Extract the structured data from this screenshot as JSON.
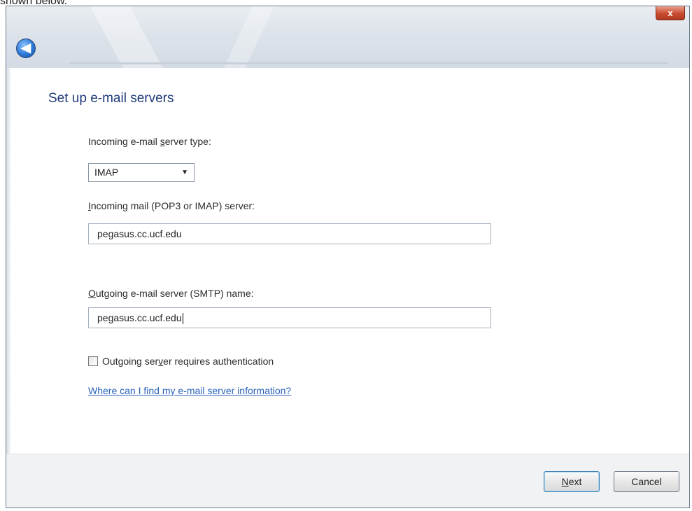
{
  "caption": "shown below.",
  "window": {
    "close_label": "x",
    "back_label": "◀"
  },
  "page": {
    "title": "Set up e-mail servers"
  },
  "form": {
    "server_type_label_pre": "Incoming e-mail ",
    "server_type_label_hot": "s",
    "server_type_label_post": "erver type:",
    "server_type_value": "IMAP",
    "incoming_label_hot": "I",
    "incoming_label_post": "ncoming mail (POP3 or IMAP) server:",
    "incoming_value": "pegasus.cc.ucf.edu",
    "outgoing_label_hot": "O",
    "outgoing_label_post": "utgoing e-mail server (SMTP) name:",
    "outgoing_value": "pegasus.cc.ucf.edu",
    "auth_label_pre": "Outgoing ser",
    "auth_label_hot": "v",
    "auth_label_post": "er requires authentication",
    "auth_checked": false,
    "help_link": "Where can I find my e-mail server information?"
  },
  "footer": {
    "next_hot": "N",
    "next_post": "ext",
    "cancel_label": "Cancel"
  },
  "colors": {
    "title": "#1e3a78",
    "link": "#2a63b8",
    "close": "#c94b30"
  }
}
